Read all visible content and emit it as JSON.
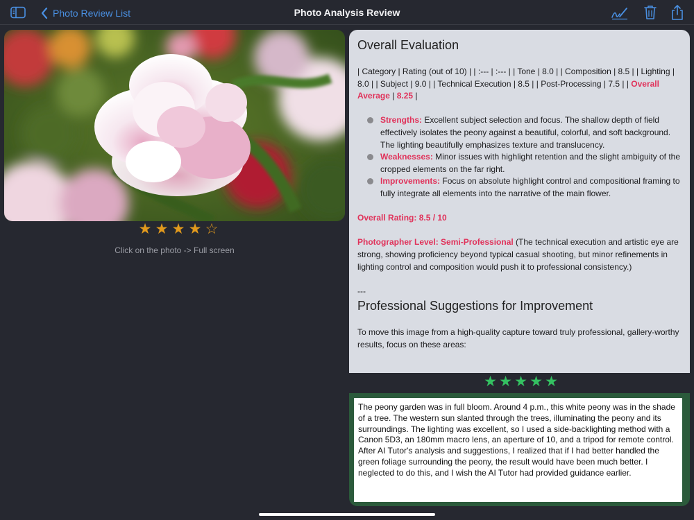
{
  "header": {
    "back_label": "Photo Review List",
    "title": "Photo Analysis Review"
  },
  "photo": {
    "stars_filled": 4,
    "stars_total": 5,
    "hint": "Click on the photo -> Full screen"
  },
  "evaluation": {
    "heading": "Overall Evaluation",
    "table_line": "| Category | Rating (out of 10) | | :--- | :--- | | Tone | 8.0 | | Composition | 8.5 | | Lighting | 8.0 | | Subject | 9.0 | | Technical Execution | 8.5 | | Post-Processing | 7.5 | | ",
    "table_avg_label": "Overall Average",
    "table_sep": " | ",
    "table_avg_value": "8.25",
    "table_end": " |",
    "strengths_label": "Strengths:",
    "strengths_text": " Excellent subject selection and focus. The shallow depth of field effectively isolates the peony against a beautiful, colorful, and soft background. The lighting beautifully emphasizes texture and translucency.",
    "weaknesses_label": "Weaknesses:",
    "weaknesses_text": " Minor issues with highlight retention and the slight ambiguity of the cropped elements on the far right.",
    "improvements_label": "Improvements:",
    "improvements_text": " Focus on absolute highlight control and compositional framing to fully integrate all elements into the narrative of the main flower.",
    "overall_rating": "Overall Rating: 8.5 / 10",
    "level_label": "Photographer Level: Semi-Professional",
    "level_text": " (The technical execution and artistic eye are strong, showing proficiency beyond typical casual shooting, but minor refinements in lighting control and composition would push it to professional consistency.)",
    "separator": "---",
    "suggestions_heading": "Professional Suggestions for Improvement",
    "suggestions_intro": "To move this image from a high-quality capture toward truly professional, gallery-worthy results, focus on these areas:"
  },
  "user_rating": {
    "stars_filled": 5,
    "stars_total": 5
  },
  "note": {
    "text": "The peony garden was in full bloom. Around 4 p.m., this white peony was in the shade of a tree. The western sun slanted through the trees, illuminating the peony and its surroundings. The lighting was excellent, so I used a side-backlighting method with a Canon 5D3, an 180mm macro lens, an aperture of 10, and a tripod for remote control. After AI Tutor's analysis and suggestions, I realized that if I had better handled the green foliage surrounding the peony, the result would have been much better. I neglected to do this, and I wish the AI Tutor had provided guidance earlier."
  },
  "colors": {
    "accent_blue": "#4a90e2",
    "highlight_red": "#e0325a",
    "star_orange": "#e29a1d",
    "star_green": "#34c061"
  },
  "icons": [
    "sidebar-icon",
    "chevron-left-icon",
    "signature-pen-icon",
    "trash-icon",
    "share-icon"
  ]
}
